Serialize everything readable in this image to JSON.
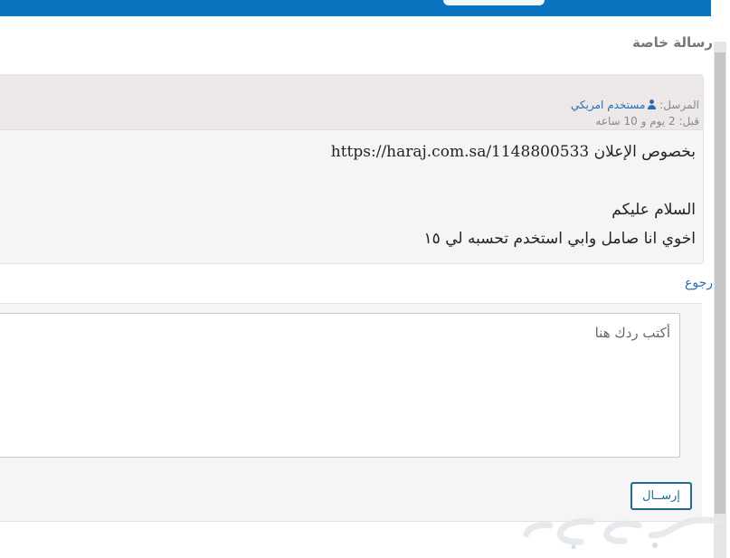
{
  "page_title": "رسالة خاصة",
  "message": {
    "sender_label": "المرسل:",
    "sender_name": "مستخدم امريكي",
    "sender_icon": "user-icon",
    "time_label": "قبل:",
    "time_value": "2 يوم و 10 ساعه",
    "lines": [
      "بخصوص الإعلان https://haraj.com.sa/1148800533",
      "السلام عليكم",
      "اخوي انا صامل وابي استخدم تحسبه لي ١٥"
    ]
  },
  "back_link": "رجوع",
  "reply": {
    "placeholder": "أكتب ردك هنا",
    "send_label": "إرســال"
  },
  "colors": {
    "header": "#0b74c0",
    "link": "#2a6db3",
    "button_border": "#1f6c8f"
  }
}
